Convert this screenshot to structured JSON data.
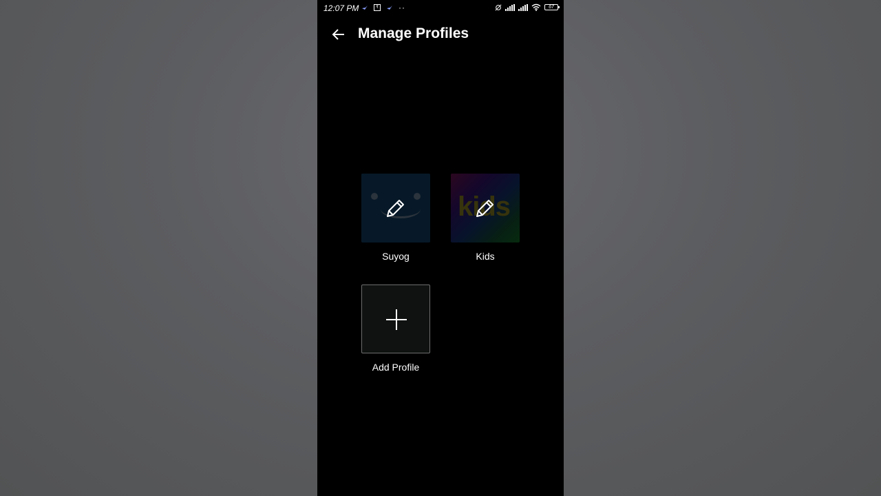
{
  "status_bar": {
    "time": "12:07 PM",
    "battery": "67",
    "dots": "··"
  },
  "header": {
    "title": "Manage Profiles"
  },
  "profiles": [
    {
      "name": "Suyog",
      "avatar": "smiley",
      "edit_icon": "pencil-icon"
    },
    {
      "name": "Kids",
      "avatar": "kids",
      "badge_text": "kids",
      "edit_icon": "pencil-icon"
    }
  ],
  "add_profile": {
    "label": "Add Profile",
    "icon": "plus-icon"
  },
  "colors": {
    "background": "#000000",
    "backdrop": "#595959",
    "suyog_tile": "#0a2236",
    "add_tile_border": "#6e6e6e"
  }
}
